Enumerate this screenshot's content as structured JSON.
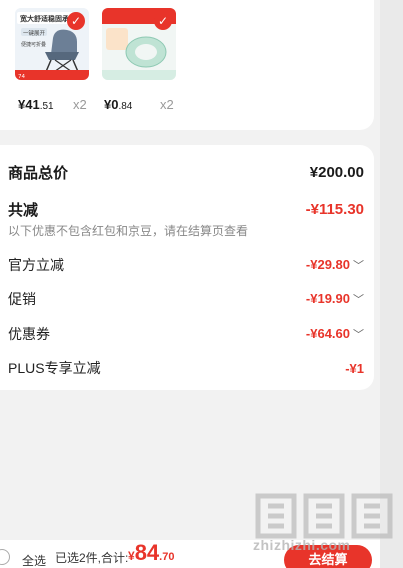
{
  "products": [
    {
      "banner": "宽大舒适稳固承重",
      "sub": "一键展开",
      "tag": "便捷可折叠",
      "price_int": "¥41",
      "price_dec": ".51",
      "qty": "x2"
    },
    {
      "banner": "",
      "price_int": "¥0",
      "price_dec": ".84",
      "qty": "x2"
    }
  ],
  "summary": {
    "total_label": "商品总价",
    "total_value": "¥200.00",
    "discount_label": "共减",
    "discount_value": "-¥115.30",
    "note": "以下优惠不包含红包和京豆，请在结算页查看",
    "items": [
      {
        "label": "官方立减",
        "value": "-¥29.80",
        "chevron": true
      },
      {
        "label": "促销",
        "value": "-¥19.90",
        "chevron": true
      },
      {
        "label": "优惠券",
        "value": "-¥64.60",
        "chevron": true
      },
      {
        "label": "PLUS专享立减",
        "value": "-¥1",
        "chevron": false
      }
    ]
  },
  "bottom": {
    "select_all": "全选",
    "selected": "已选2件,合计:",
    "currency": "¥",
    "total_int": "84",
    "total_dec": ".70",
    "checkout": "去结算"
  },
  "watermark": {
    "glyphs": "值值值",
    "url": "zhizhizhi.com"
  },
  "colors": {
    "accent": "#e8342a",
    "background": "#f2f2f2"
  }
}
